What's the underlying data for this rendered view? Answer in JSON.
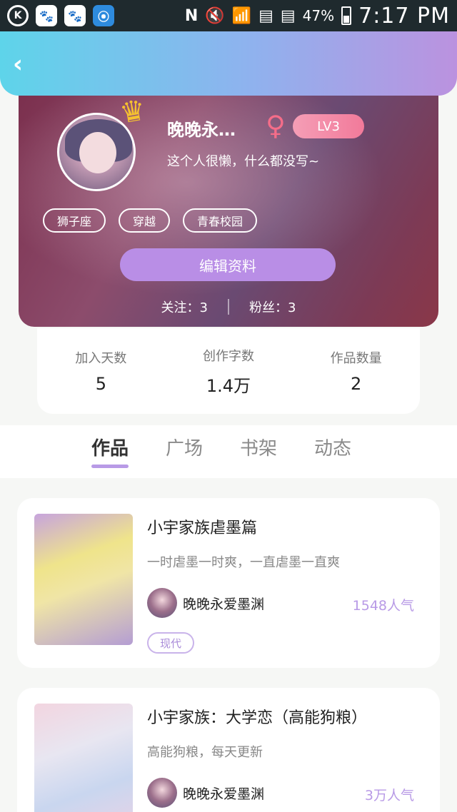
{
  "status_bar": {
    "left_icons": [
      "k-circle-icon",
      "paw-icon",
      "paw-icon",
      "signal-app-icon"
    ],
    "battery": "47%",
    "time": "7:17 PM"
  },
  "header": {
    "back_icon": "chevron-left-icon"
  },
  "profile": {
    "nickname": "晚晚永…",
    "gender_symbol": "♀",
    "level": "LV3",
    "bio": "这个人很懒，什么都没写~",
    "tags": [
      "狮子座",
      "穿越",
      "青春校园"
    ],
    "edit_button": "编辑资料",
    "follow_label": "关注：",
    "follow_count": "3",
    "fans_label": "粉丝：",
    "fans_count": "3"
  },
  "stats": [
    {
      "label": "加入天数",
      "value": "5"
    },
    {
      "label": "创作字数",
      "value": "1.4万"
    },
    {
      "label": "作品数量",
      "value": "2"
    }
  ],
  "tabs": [
    {
      "label": "作品",
      "active": true
    },
    {
      "label": "广场",
      "active": false
    },
    {
      "label": "书架",
      "active": false
    },
    {
      "label": "动态",
      "active": false
    }
  ],
  "works": [
    {
      "title": "小宇家族虐墨篇",
      "desc": "一时虐墨一时爽，一直虐墨一直爽",
      "author": "晚晚永爱墨渊",
      "popularity": "1548人气",
      "genre": "现代"
    },
    {
      "title": "小宇家族：大学恋（高能狗粮）",
      "desc": "高能狗粮，每天更新",
      "author": "晚晚永爱墨渊",
      "popularity": "3万人气"
    }
  ],
  "colors": {
    "accent": "#b89ae6",
    "header_gradient_start": "#5ed4ea",
    "header_gradient_end": "#bb92df",
    "level_badge": "#f27a9a"
  }
}
